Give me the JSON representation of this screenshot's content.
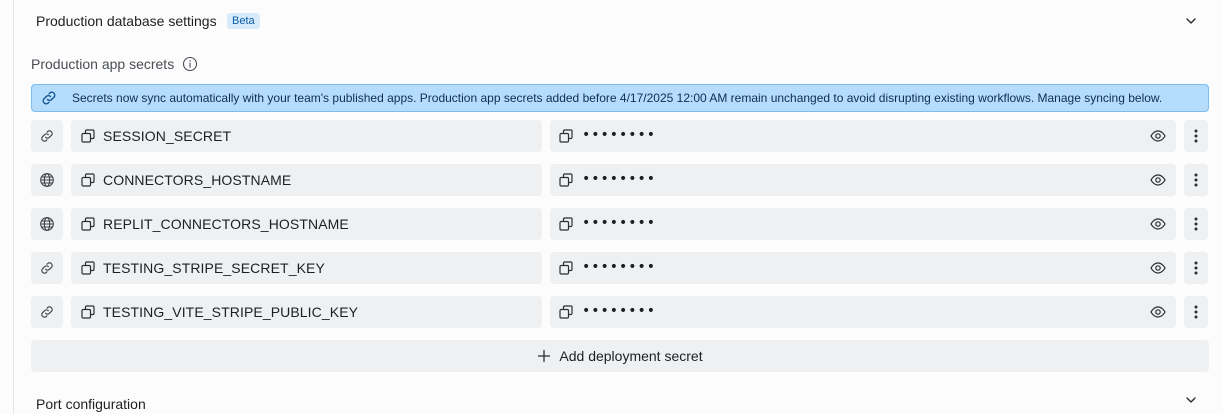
{
  "sections": {
    "db_settings": {
      "title": "Production database settings",
      "badge": "Beta"
    },
    "port_config": {
      "title": "Port configuration"
    }
  },
  "secrets_label": "Production app secrets",
  "banner": {
    "text": "Secrets now sync automatically with your team's published apps. Production app secrets added before 4/17/2025 12:00 AM remain unchanged to avoid disrupting existing workflows. Manage syncing below.",
    "icon": "link-icon"
  },
  "secrets": [
    {
      "type": "link",
      "key": "SESSION_SECRET",
      "value": "••••••••"
    },
    {
      "type": "globe",
      "key": "CONNECTORS_HOSTNAME",
      "value": "••••••••"
    },
    {
      "type": "globe",
      "key": "REPLIT_CONNECTORS_HOSTNAME",
      "value": "••••••••"
    },
    {
      "type": "link",
      "key": "TESTING_STRIPE_SECRET_KEY",
      "value": "••••••••"
    },
    {
      "type": "link",
      "key": "TESTING_VITE_STRIPE_PUBLIC_KEY",
      "value": "••••••••"
    }
  ],
  "add_button": {
    "label": "Add deployment secret"
  },
  "colors": {
    "banner_bg": "#b6dcfb",
    "banner_border": "#7ebcf0",
    "badge_bg": "#d7ebfb",
    "field_bg": "#eff0f2"
  }
}
